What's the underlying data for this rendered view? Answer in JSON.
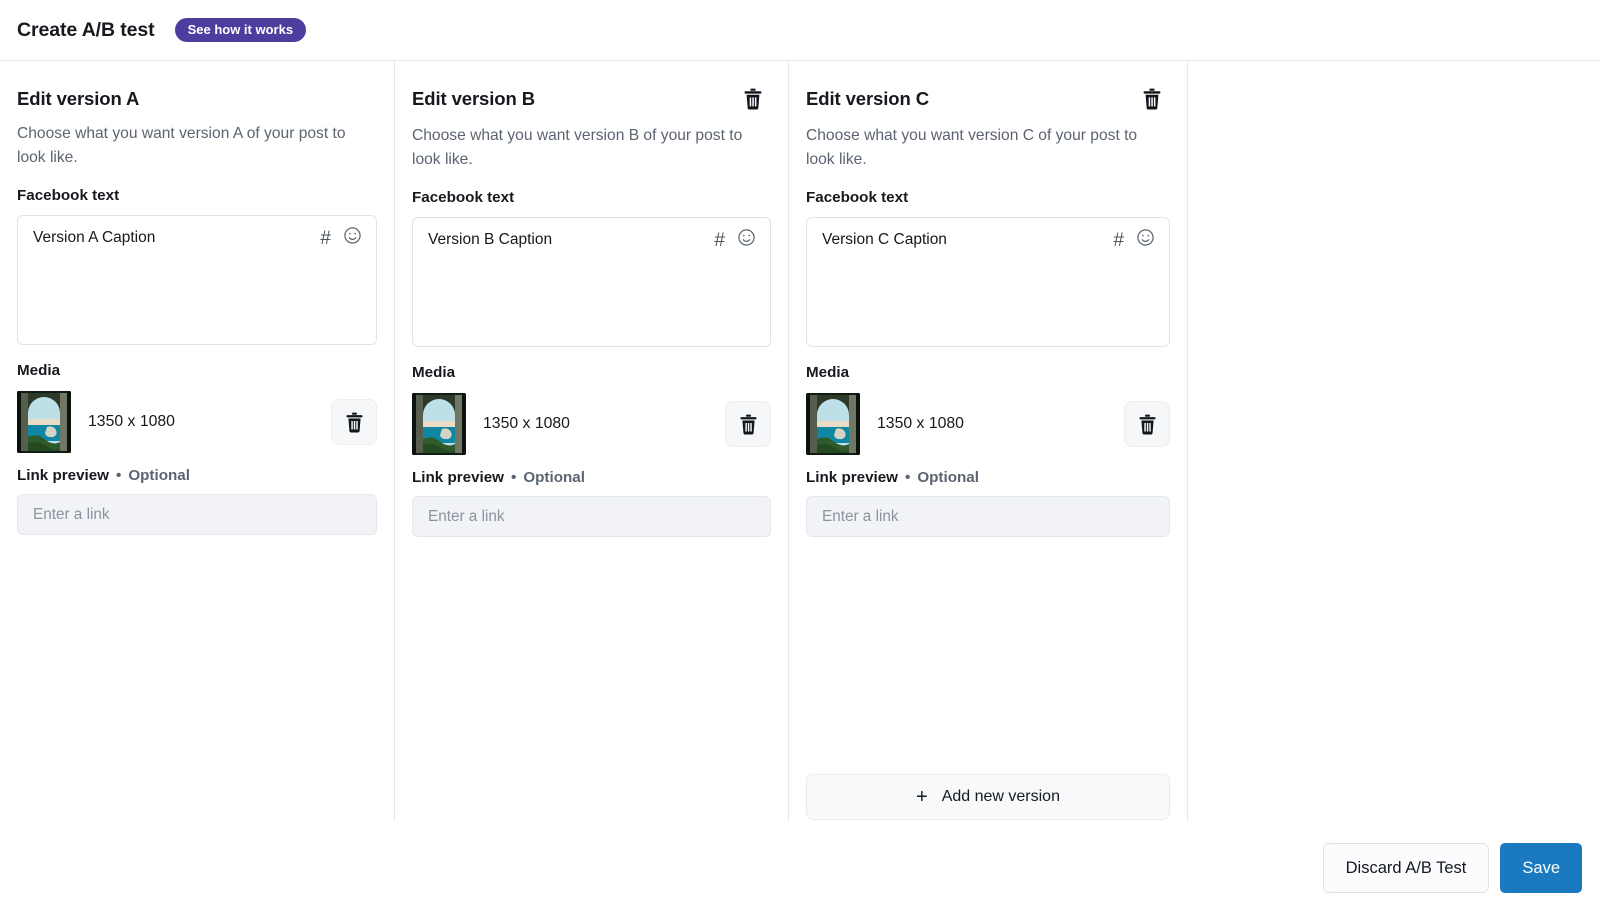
{
  "header": {
    "title": "Create A/B test",
    "pill_label": "See how it works"
  },
  "versions": [
    {
      "title": "Edit version A",
      "subtitle": "Choose what you want version A of your post to look like.",
      "text_label": "Facebook text",
      "caption": "Version A Caption",
      "hash_icon": "hashtag-icon",
      "emoji_icon": "smiley-icon",
      "media_label": "Media",
      "media_dims": "1350 x 1080",
      "media_delete_icon": "trash-icon",
      "link_label": "Link preview",
      "link_separator": "•",
      "link_optional": "Optional",
      "link_placeholder": "Enter a link",
      "link_value": "",
      "has_delete": false,
      "delete_icon": "trash-icon"
    },
    {
      "title": "Edit version B",
      "subtitle": "Choose what you want version B of your post to look like.",
      "text_label": "Facebook text",
      "caption": "Version B Caption",
      "hash_icon": "hashtag-icon",
      "emoji_icon": "smiley-icon",
      "media_label": "Media",
      "media_dims": "1350 x 1080",
      "media_delete_icon": "trash-icon",
      "link_label": "Link preview",
      "link_separator": "•",
      "link_optional": "Optional",
      "link_placeholder": "Enter a link",
      "link_value": "",
      "has_delete": true,
      "delete_icon": "trash-icon"
    },
    {
      "title": "Edit version C",
      "subtitle": "Choose what you want version C of your post to look like.",
      "text_label": "Facebook text",
      "caption": "Version C Caption",
      "hash_icon": "hashtag-icon",
      "emoji_icon": "smiley-icon",
      "media_label": "Media",
      "media_dims": "1350 x 1080",
      "media_delete_icon": "trash-icon",
      "link_label": "Link preview",
      "link_separator": "•",
      "link_optional": "Optional",
      "link_placeholder": "Enter a link",
      "link_value": "",
      "has_delete": true,
      "delete_icon": "trash-icon"
    }
  ],
  "add_version": {
    "label": "Add new version",
    "plus_icon": "plus-icon"
  },
  "footer": {
    "discard_label": "Discard A/B Test",
    "save_label": "Save"
  },
  "colors": {
    "pill_purple": "#4c3d9e",
    "save_blue": "#1b79c0",
    "text_primary": "#16191d",
    "text_muted": "#5b6470",
    "border": "#e6e8eb",
    "input_fill": "#f1f3f6"
  }
}
